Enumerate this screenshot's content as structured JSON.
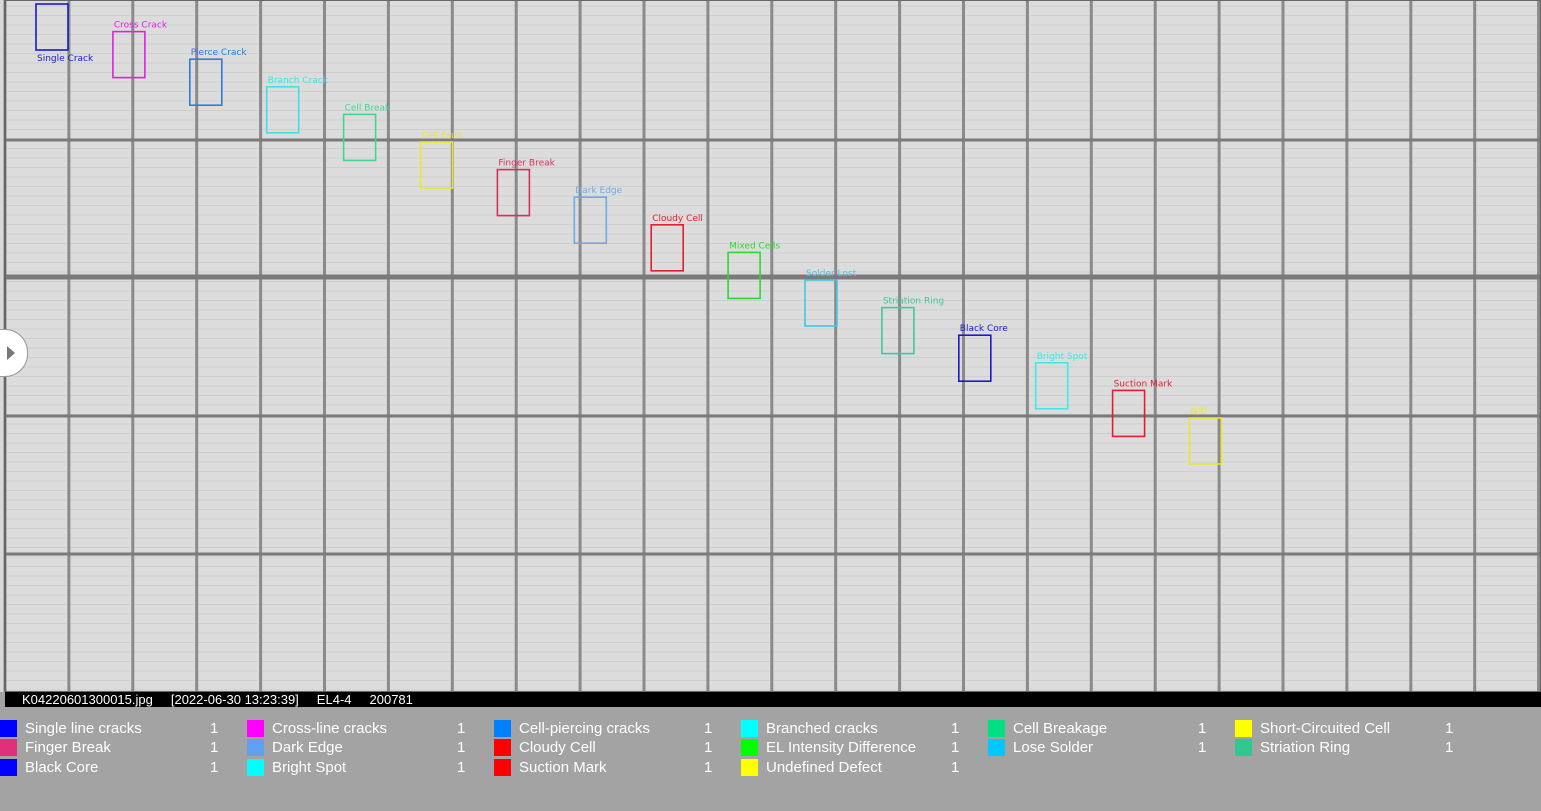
{
  "detections": [
    {
      "label": "Single Crack",
      "color": "#1a1acc"
    },
    {
      "label": "Cross Crack",
      "color": "#e020e0"
    },
    {
      "label": "Pierce Crack",
      "color": "#2a7fd8"
    },
    {
      "label": "Branch Crack",
      "color": "#40e0e8"
    },
    {
      "label": "Cell Break",
      "color": "#40d890"
    },
    {
      "label": "Cell Fault",
      "color": "#e8e830"
    },
    {
      "label": "Finger Break",
      "color": "#d8305a"
    },
    {
      "label": "Dark Edge",
      "color": "#70a8e8"
    },
    {
      "label": "Cloudy Cell",
      "color": "#e02030"
    },
    {
      "label": "Mixed Cells",
      "color": "#30d830"
    },
    {
      "label": "Solder Lost",
      "color": "#40c8e8"
    },
    {
      "label": "Striation Ring",
      "color": "#40c8a0"
    },
    {
      "label": "Black Core",
      "color": "#1a1acc"
    },
    {
      "label": "Bright Spot",
      "color": "#40e8e8"
    },
    {
      "label": "Suction Mark",
      "color": "#e02030"
    },
    {
      "label": "N/D",
      "color": "#e8e830"
    }
  ],
  "info": {
    "filename": "K04220601300015.jpg",
    "timestamp": "[2022-06-30 13:23:39]",
    "station": "EL4-4",
    "id": "200781"
  },
  "legend": [
    {
      "label": "Single line cracks",
      "count": "1",
      "color": "#0000ff"
    },
    {
      "label": "Cross-line cracks",
      "count": "1",
      "color": "#ff00ff"
    },
    {
      "label": "Cell-piercing cracks",
      "count": "1",
      "color": "#0080ff"
    },
    {
      "label": "Branched cracks",
      "count": "1",
      "color": "#00ffff"
    },
    {
      "label": "Cell Breakage",
      "count": "1",
      "color": "#00e080"
    },
    {
      "label": "Short-Circuited Cell",
      "count": "1",
      "color": "#ffff00"
    },
    {
      "label": "Finger Break",
      "count": "1",
      "color": "#e0307a"
    },
    {
      "label": "Dark Edge",
      "count": "1",
      "color": "#60a0f0"
    },
    {
      "label": "Cloudy Cell",
      "count": "1",
      "color": "#ff0000"
    },
    {
      "label": "EL Intensity Difference",
      "count": "1",
      "color": "#00ff00"
    },
    {
      "label": "Lose Solder",
      "count": "1",
      "color": "#00c8ff"
    },
    {
      "label": "Striation Ring",
      "count": "1",
      "color": "#30c890"
    },
    {
      "label": "Black Core",
      "count": "1",
      "color": "#0000ff"
    },
    {
      "label": "Bright Spot",
      "count": "1",
      "color": "#00ffff"
    },
    {
      "label": "Suction Mark",
      "count": "1",
      "color": "#ff0000"
    },
    {
      "label": "Undefined Defect",
      "count": "1",
      "color": "#ffff00"
    }
  ]
}
